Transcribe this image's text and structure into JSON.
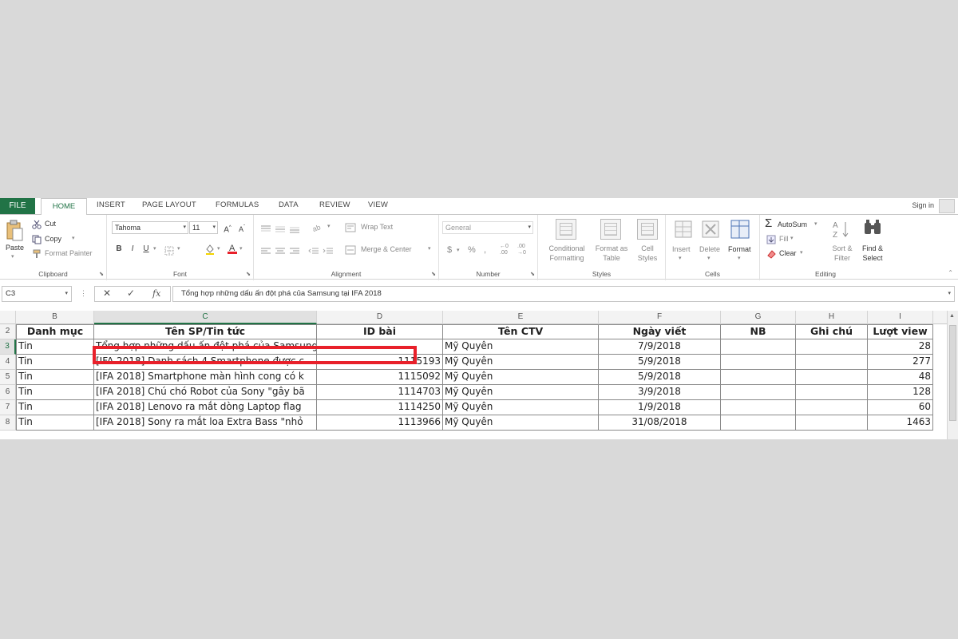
{
  "tabs": {
    "file": "FILE",
    "home": "HOME",
    "insert": "INSERT",
    "page_layout": "PAGE LAYOUT",
    "formulas": "FORMULAS",
    "data": "DATA",
    "review": "REVIEW",
    "view": "VIEW",
    "sign_in": "Sign in"
  },
  "clipboard": {
    "paste": "Paste",
    "cut": "Cut",
    "copy": "Copy",
    "format_painter": "Format Painter",
    "label": "Clipboard"
  },
  "font": {
    "name": "Tahoma",
    "size": "11",
    "label": "Font"
  },
  "alignment": {
    "wrap_text": "Wrap Text",
    "merge_center": "Merge & Center",
    "label": "Alignment"
  },
  "number": {
    "format": "General",
    "label": "Number"
  },
  "styles": {
    "conditional_1": "Conditional",
    "conditional_2": "Formatting",
    "format_as_1": "Format as",
    "format_as_2": "Table",
    "cell_styles_1": "Cell",
    "cell_styles_2": "Styles",
    "label": "Styles"
  },
  "cells": {
    "insert": "Insert",
    "delete": "Delete",
    "format": "Format",
    "label": "Cells"
  },
  "editing": {
    "autosum": "AutoSum",
    "fill": "Fill",
    "clear": "Clear",
    "sort_1": "Sort &",
    "sort_2": "Filter",
    "find_1": "Find &",
    "find_2": "Select",
    "label": "Editing"
  },
  "formula_bar": {
    "name_box": "C3",
    "cancel": "✕",
    "enter": "✓",
    "fx": "fx",
    "content": "Tổng hợp những dấu ấn đột phá của Samsung tại IFA 2018"
  },
  "columns": [
    "B",
    "C",
    "D",
    "E",
    "F",
    "G",
    "H",
    "I"
  ],
  "row_numbers": [
    "2",
    "3",
    "4",
    "5",
    "6",
    "7",
    "8"
  ],
  "header_row": [
    "Danh mục",
    "Tên SP/Tin tức",
    "ID bài",
    "Tên CTV",
    "Ngày viết",
    "NB",
    "Ghi chú",
    "Lượt view"
  ],
  "rows": [
    [
      "Tin",
      "Tổng hợp những dấu ấn đột phá của Samsung tại IFA 2018",
      "",
      "Mỹ Quyên",
      "7/9/2018",
      "",
      "",
      "28"
    ],
    [
      "Tin",
      "[IFA 2018] Danh sách 4 Smartphone được c",
      "1115193",
      "Mỹ Quyên",
      "5/9/2018",
      "",
      "",
      "277"
    ],
    [
      "Tin",
      "[IFA 2018] Smartphone màn hình cong có k",
      "1115092",
      "Mỹ Quyên",
      "5/9/2018",
      "",
      "",
      "48"
    ],
    [
      "Tin",
      "[IFA 2018] Chú chó Robot của Sony \"gây bã",
      "1114703",
      "Mỹ Quyên",
      "3/9/2018",
      "",
      "",
      "128"
    ],
    [
      "Tin",
      "[IFA 2018] Lenovo ra mắt dòng Laptop flag",
      "1114250",
      "Mỹ Quyên",
      "1/9/2018",
      "",
      "",
      "60"
    ],
    [
      "Tin",
      "[IFA 2018] Sony ra mắt loa Extra Bass \"nhỏ",
      "1113966",
      "Mỹ Quyên",
      "31/08/2018",
      "",
      "",
      "1463"
    ]
  ]
}
